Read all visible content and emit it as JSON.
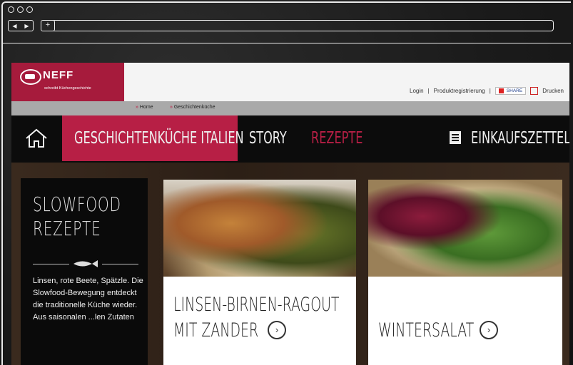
{
  "site": {
    "brand": "NEFF",
    "tagline": "schreibt Küchengeschichte",
    "header": {
      "login": "Login",
      "sep": "|",
      "register": "Produktregistrierung",
      "share": "SHARE",
      "print": "Drucken"
    },
    "breadcrumb": [
      "Home",
      "Geschichtenküche"
    ],
    "nav": {
      "active": "GESCHICHTENKÜCHE ITALIEN",
      "story": "STORY",
      "recipes": "REZEPTE",
      "shopping": "EINKAUFSZETTEL"
    },
    "sidebar": {
      "title_line1": "SLOWFOOD",
      "title_line2": "REZEPTE",
      "text": "Linsen, rote Beete, Spätzle. Die Slowfood-Bewegung entdeckt die traditionelle Küche wieder. Aus saisonalen ...len Zutaten"
    },
    "cards": [
      {
        "title_line1": "LINSEN-BIRNEN-RAGOUT",
        "title_line2": "MIT ZANDER"
      },
      {
        "title_line1": "WINTERSALAT"
      }
    ]
  },
  "colors": {
    "brand": "#a61b3c",
    "nav_active": "#b71f45",
    "recipes_text": "#b71f45"
  },
  "icons": {
    "home": "home-icon",
    "cart": "shopping-list-icon",
    "arrow": "chevron-right-circle-icon",
    "fish": "fish-icon"
  }
}
